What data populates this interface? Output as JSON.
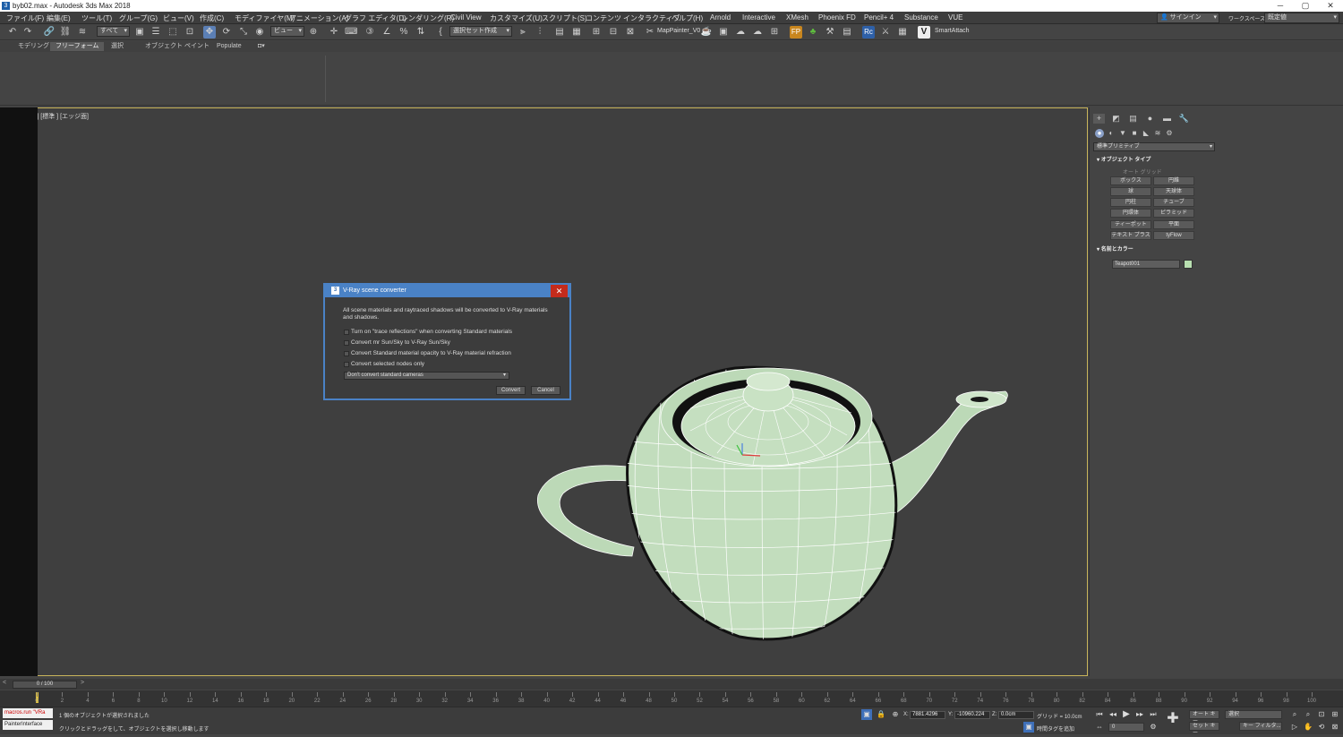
{
  "window": {
    "title": "byb02.max - Autodesk 3ds Max 2018",
    "app_icon": "3"
  },
  "window_controls": {
    "minimize": "─",
    "maximize": "▢",
    "close": "✕"
  },
  "menu": [
    "ファイル(F)",
    "編集(E)",
    "ツール(T)",
    "グループ(G)",
    "ビュー(V)",
    "作成(C)",
    "モディファイヤ(M)",
    "アニメーション(A)",
    "グラフ エディタ(D)",
    "レンダリング(R)",
    "Civil View",
    "カスタマイズ(U)",
    "スクリプト(S)",
    "コンテンツ",
    "インタラクティブ",
    "ヘルプ(H)",
    "Arnold",
    "Interactive",
    "XMesh",
    "Phoenix FD",
    "Pencil+ 4",
    "Substance",
    "VUE"
  ],
  "signin": {
    "label": "サインイン",
    "workspace_label": "ワークスペース:",
    "workspace_value": "既定値"
  },
  "toolbar": {
    "filter_combo": "すべて",
    "view_combo": "ビュー",
    "selection_set": "選択セット作成",
    "mappainter": "MapPainter_V0",
    "smartattach": "SmartAttach",
    "fp_label": "FP",
    "rc_label": "Rc",
    "v_label": "V"
  },
  "ribbon_tabs": [
    "モデリング",
    "フリーフォーム",
    "選択",
    "オブジェクト ペイント",
    "Populate"
  ],
  "ribbon_active_tab": 1,
  "viewport": {
    "label": "[+] [ パース ] [標準 ] [エッジ面]"
  },
  "command_panel": {
    "tabs": [
      "+",
      "◩",
      "▤",
      "●",
      "▬",
      "🔧"
    ],
    "active_tab": 0,
    "subtabs": [
      "●",
      "◐",
      "▼",
      "■",
      "◣",
      "≋",
      "⚙"
    ],
    "active_subtab": 0,
    "primitive_type": "標準プリミティブ",
    "object_type_header": "オブジェクト タイプ",
    "autogrid": "オート グリッド",
    "object_buttons": [
      "ボックス",
      "円錐",
      "球",
      "天球体",
      "円柱",
      "チューブ",
      "円環体",
      "ピラミッド",
      "ティーポット",
      "平面",
      "テキスト プラス",
      "tyFlow"
    ],
    "name_color_header": "名前とカラー",
    "object_name": "Teapot001",
    "object_color": "#b9e0b1"
  },
  "dialog": {
    "title": "V-Ray scene converter",
    "description": "All scene materials and raytraced shadows will be converted to V-Ray materials and shadows.",
    "checkboxes": [
      "Turn on \"trace reflections\" when converting Standard materials",
      "Convert mr Sun/Sky to V-Ray Sun/Sky",
      "Convert Standard material opacity to V-Ray material refraction",
      "Convert selected nodes only"
    ],
    "camera_option": "Don't convert standard cameras",
    "convert_label": "Convert",
    "cancel_label": "Cancel"
  },
  "timeline": {
    "slider_value": "0 / 100",
    "ticks": [
      "0",
      "2",
      "4",
      "6",
      "8",
      "10",
      "12",
      "14",
      "16",
      "18",
      "20",
      "22",
      "24",
      "26",
      "28",
      "30",
      "32",
      "34",
      "36",
      "38",
      "40",
      "42",
      "44",
      "46",
      "48",
      "50",
      "52",
      "54",
      "56",
      "58",
      "60",
      "62",
      "64",
      "66",
      "68",
      "70",
      "72",
      "74",
      "76",
      "78",
      "80",
      "82",
      "84",
      "86",
      "88",
      "90",
      "92",
      "94",
      "96",
      "98",
      "100"
    ]
  },
  "status": {
    "macro_line1": "macros.run \"VRa",
    "macro_line2": "PainterInterface",
    "message1": "1 個のオブジェクトが選択されました",
    "message2": "クリックとドラッグをして、オブジェクトを選択し移動します",
    "x_label": "X:",
    "x_value": "7881.4296",
    "y_label": "Y:",
    "y_value": "-10960.224",
    "z_label": "Z:",
    "z_value": "0.0cm",
    "grid": "グリッド = 10.0cm",
    "time_tag": "時間タグを追加",
    "autokey": "オート キー",
    "setkey": "セット キー",
    "selection_combo": "選択",
    "key_filter": "キー フィルタ...",
    "frame_value": "0"
  }
}
